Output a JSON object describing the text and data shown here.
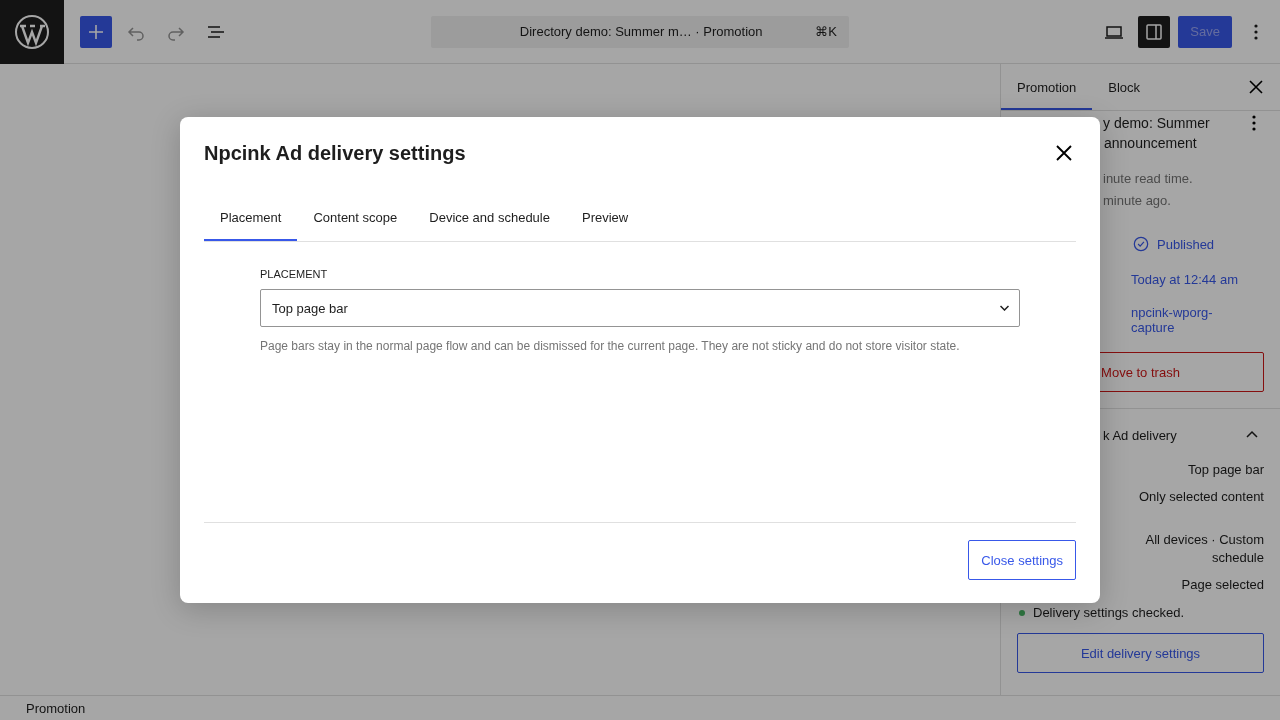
{
  "topbar": {
    "command": {
      "title": "Directory demo: Summer m… · Promotion",
      "shortcut": "⌘K"
    },
    "save": "Save"
  },
  "sidebar": {
    "tabs": [
      {
        "label": "Promotion",
        "selected": true
      },
      {
        "label": "Block",
        "selected": false
      }
    ],
    "summary": {
      "title_lines": [
        "y demo: Summer",
        "announcement"
      ],
      "meta": [
        "inute read time.",
        "minute ago."
      ]
    },
    "details": [
      {
        "kind": "status",
        "value": "Published"
      },
      {
        "kind": "link",
        "value": "Today at 12:44 am"
      },
      {
        "kind": "link",
        "value": "npcink-wporg-capture"
      }
    ],
    "trash": "Move to trash",
    "delivery": {
      "heading": "k Ad delivery",
      "expanded": true,
      "values": [
        "Top page bar",
        "Only selected content",
        "All devices · Custom schedule",
        "Page selected"
      ],
      "notice": {
        "text": "Delivery settings checked."
      },
      "button": "Edit delivery settings"
    }
  },
  "modal": {
    "title": "Npcink Ad delivery settings",
    "tabs": [
      {
        "label": "Placement",
        "selected": true
      },
      {
        "label": "Content scope",
        "selected": false
      },
      {
        "label": "Device and schedule",
        "selected": false
      },
      {
        "label": "Preview",
        "selected": false
      }
    ],
    "field": {
      "label": "PLACEMENT",
      "value": "Top page bar"
    },
    "help": "Page bars stay in the normal page flow and can be dismissed for the current page. They are not sticky and do not store visitor state.",
    "button": "Close settings"
  },
  "footer": "Promotion"
}
